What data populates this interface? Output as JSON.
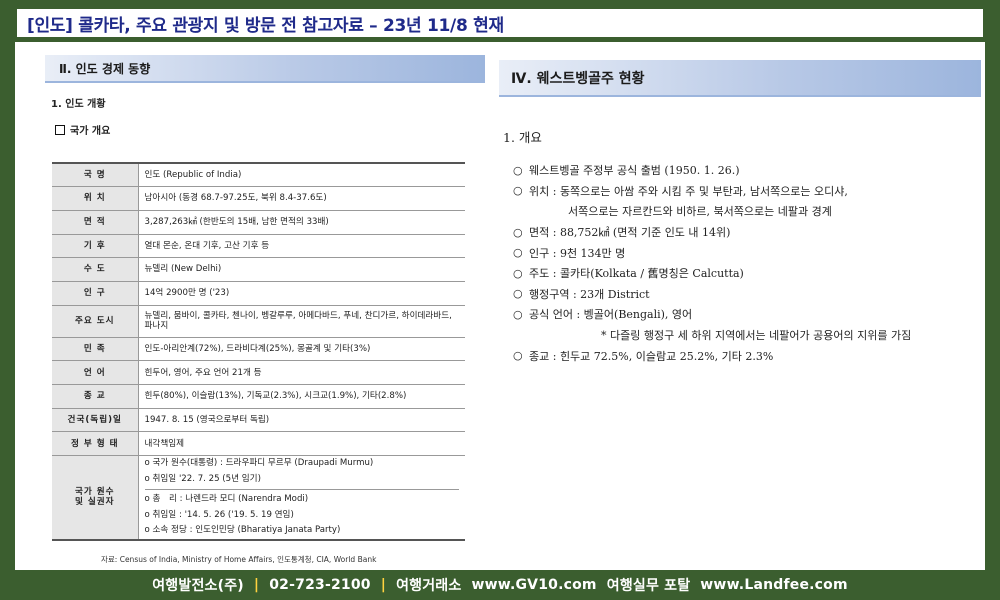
{
  "header": {
    "title": "[인도] 콜카타, 주요 관광지 및 방문 전 참고자료 – 23년 11/8 현재"
  },
  "left": {
    "section_title": "Ⅱ. 인도 경제 동향",
    "sub1": "1. 인도 개황",
    "sub2": "국가 개요",
    "rows": [
      {
        "k": "국 명",
        "v": "인도 (Republic of India)"
      },
      {
        "k": "위 치",
        "v": "남아시아 (동경 68.7-97.25도, 북위 8.4-37.6도)"
      },
      {
        "k": "면 적",
        "v": "3,287,263㎢ (한반도의 15배, 남한 면적의 33배)"
      },
      {
        "k": "기 후",
        "v": "열대 몬순, 온대 기후, 고산 기후 등"
      },
      {
        "k": "수 도",
        "v": "뉴델리 (New Delhi)"
      },
      {
        "k": "인 구",
        "v": "14억 2900만 명 ('23)"
      },
      {
        "k": "주요 도시",
        "v": "뉴델리, 뭄바이, 콜카타, 첸나이, 벵갈루루, 아메다바드, 푸네, 찬디가르, 하이데라바드, 파나지"
      },
      {
        "k": "민 족",
        "v": "인도-아리안계(72%), 드라비다계(25%), 몽골계 및 기타(3%)"
      },
      {
        "k": "언 어",
        "v": "힌두어, 영어, 주요 언어 21개 등"
      },
      {
        "k": "종 교",
        "v": "힌두(80%), 이슬람(13%), 기독교(2.3%), 시크교(1.9%), 기타(2.8%)"
      },
      {
        "k": "건국(독립)일",
        "v": "1947. 8. 15 (영국으로부터 독립)"
      },
      {
        "k": "정 부 형 태",
        "v": "내각책임제"
      }
    ],
    "leader_key_1": "국가 원수",
    "leader_key_2": "및 실권자",
    "leaders": [
      "o 국가 원수(대통령) : 드라우파디 무르무 (Draupadi Murmu)",
      "o 취임일 '22. 7. 25 (5년 임기)",
      "o 총　리 : 나렌드라 모디 (Narendra Modi)",
      "o 취임일 : '14. 5. 26 ('19. 5. 19 연임)",
      "o 소속 정당 : 인도인민당 (Bharatiya Janata Party)"
    ],
    "source": "자료: Census of India, Ministry of Home Affairs, 인도통계청, CIA, World Bank"
  },
  "right": {
    "section_title": "Ⅳ. 웨스트벵골주 현황",
    "sub": "1. 개요",
    "items": [
      {
        "b": "○",
        "t": "웨스트벵골 주정부 공식 출범 (1950. 1. 26.)"
      },
      {
        "b": "○",
        "t": "위치 : 동쪽으로는 아쌈 주와 시킴 주 및 부탄과, 남서쪽으로는 오디샤,"
      },
      {
        "b": "",
        "t": "서쪽으로는 자르칸드와 비하르, 북서쪽으로는 네팔과 경계",
        "cls": "ind"
      },
      {
        "b": "○",
        "t": "면적 : 88,752㎢ (면적 기준 인도 내 14위)"
      },
      {
        "b": "○",
        "t": "인구 : 9천 134만 명"
      },
      {
        "b": "○",
        "t": "주도 : 콜카타(Kolkata / 舊명칭은 Calcutta)"
      },
      {
        "b": "○",
        "t": "행정구역 : 23개 District"
      },
      {
        "b": "○",
        "t": "공식 언어 : 벵골어(Bengali), 영어"
      },
      {
        "b": "",
        "t": "* 다즐링 행정구 세 하위 지역에서는 네팔어가 공용어의 지위를 가짐",
        "cls": "note"
      },
      {
        "b": "○",
        "t": "종교 : 힌두교 72.5%, 이슬람교 25.2%, 기타 2.3%"
      }
    ]
  },
  "footer": {
    "company": "여행발전소(주)",
    "phone": "02-723-2100",
    "label1": "여행거래소",
    "site1": "www.GV10.com",
    "label2": "여행실무 포탈",
    "site2": "www.Landfee.com",
    "sep": "|"
  },
  "colors": {
    "background": "#3b5e2f",
    "title": "#1f2a8a",
    "separator": "#ffd23f"
  }
}
